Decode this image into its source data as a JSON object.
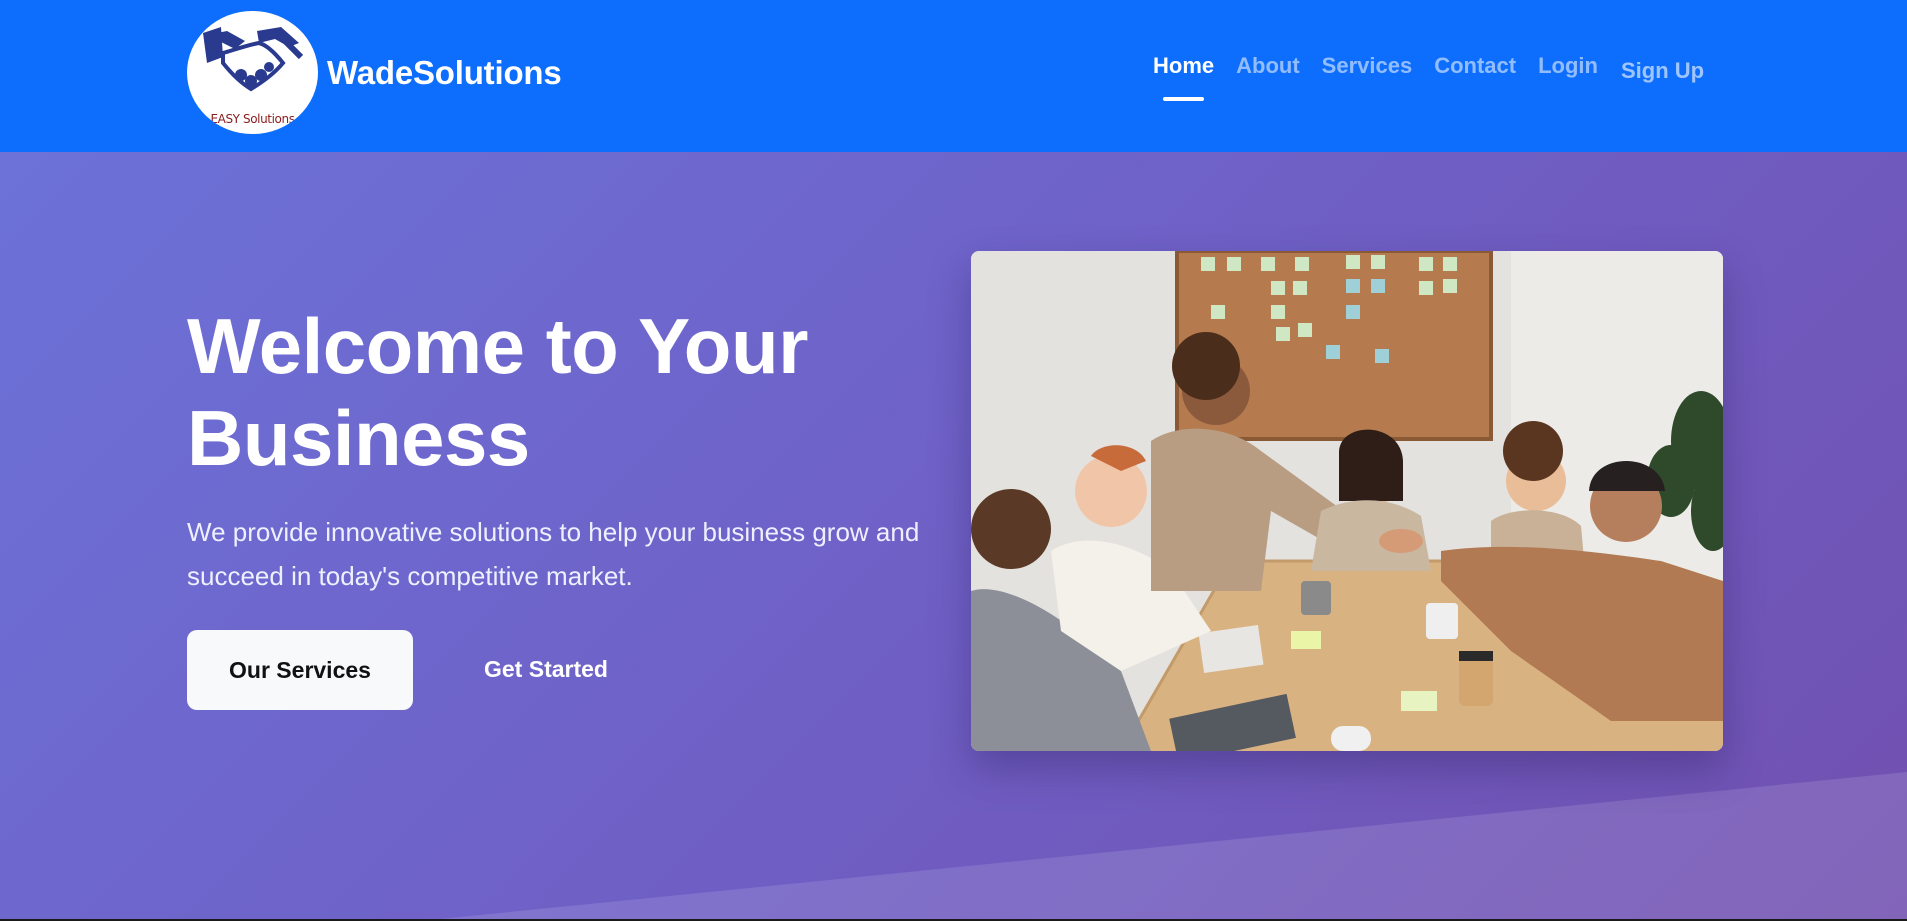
{
  "header": {
    "logo_text": "EASY Solutions",
    "brand_name": "WadeSolutions",
    "nav": [
      {
        "label": "Home",
        "active": true
      },
      {
        "label": "About",
        "active": false
      },
      {
        "label": "Services",
        "active": false
      },
      {
        "label": "Contact",
        "active": false
      },
      {
        "label": "Login",
        "active": false
      }
    ],
    "signup_label": "Sign Up"
  },
  "hero": {
    "title": "Welcome to Your Business",
    "subtitle": "We provide innovative solutions to help your business grow and succeed in today's competitive market.",
    "primary_button": "Our Services",
    "secondary_button": "Get Started",
    "image_icon": "meeting-photo"
  },
  "colors": {
    "navbar": "#0d6efd",
    "hero_start": "#6c72d8",
    "hero_end": "#7150b0",
    "button_bg": "#f8f9fa"
  }
}
